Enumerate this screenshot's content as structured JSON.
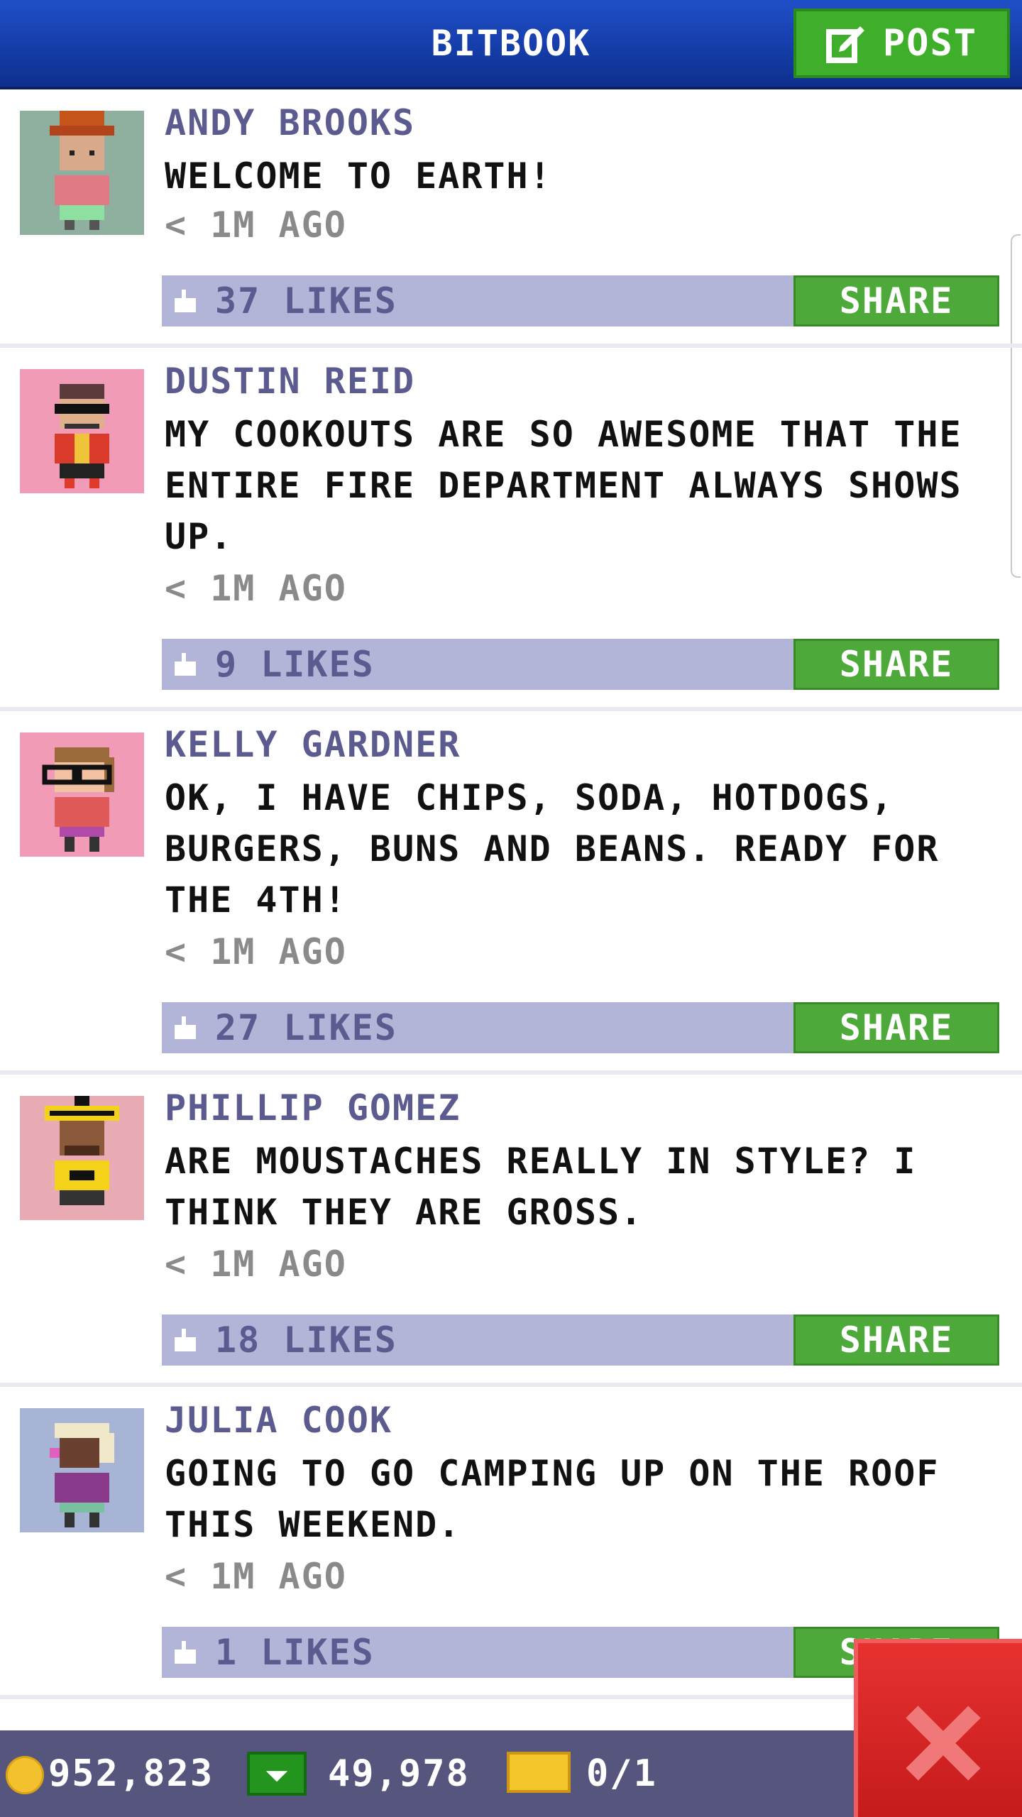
{
  "header": {
    "title": "BITBOOK",
    "post_label": "POST"
  },
  "posts": [
    {
      "author": "ANDY BROOKS",
      "message": "WELCOME TO EARTH!",
      "time": "< 1M AGO",
      "likes": "37 LIKES",
      "share": "SHARE",
      "avatar_bg": "#8fb09f"
    },
    {
      "author": "DUSTIN REID",
      "message": "MY COOKOUTS ARE SO AWESOME THAT THE ENTIRE FIRE DEPARTMENT ALWAYS SHOWS UP.",
      "time": "< 1M AGO",
      "likes": "9 LIKES",
      "share": "SHARE",
      "avatar_bg": "#f29bb6"
    },
    {
      "author": "KELLY GARDNER",
      "message": "OK, I HAVE CHIPS, SODA, HOTDOGS, BURGERS, BUNS AND BEANS. READY FOR THE 4TH!",
      "time": "< 1M AGO",
      "likes": "27 LIKES",
      "share": "SHARE",
      "avatar_bg": "#f29bb6"
    },
    {
      "author": "PHILLIP GOMEZ",
      "message": "ARE MOUSTACHES REALLY IN STYLE? I THINK THEY ARE GROSS.",
      "time": "< 1M AGO",
      "likes": "18 LIKES",
      "share": "SHARE",
      "avatar_bg": "#e8aab3"
    },
    {
      "author": "JULIA COOK",
      "message": "GOING TO GO CAMPING UP ON THE ROOF THIS WEEKEND.",
      "time": "< 1M AGO",
      "likes": "1 LIKES",
      "share": "SHARE",
      "avatar_bg": "#a8b4d6"
    }
  ],
  "status": {
    "coins": "952,823",
    "bux": "49,978",
    "tickets": "0/1"
  },
  "colors": {
    "header_blue": "#1f4fc8",
    "share_green": "#4ca93a",
    "likes_bar": "#b3b5d8",
    "close_red": "#d62424"
  }
}
